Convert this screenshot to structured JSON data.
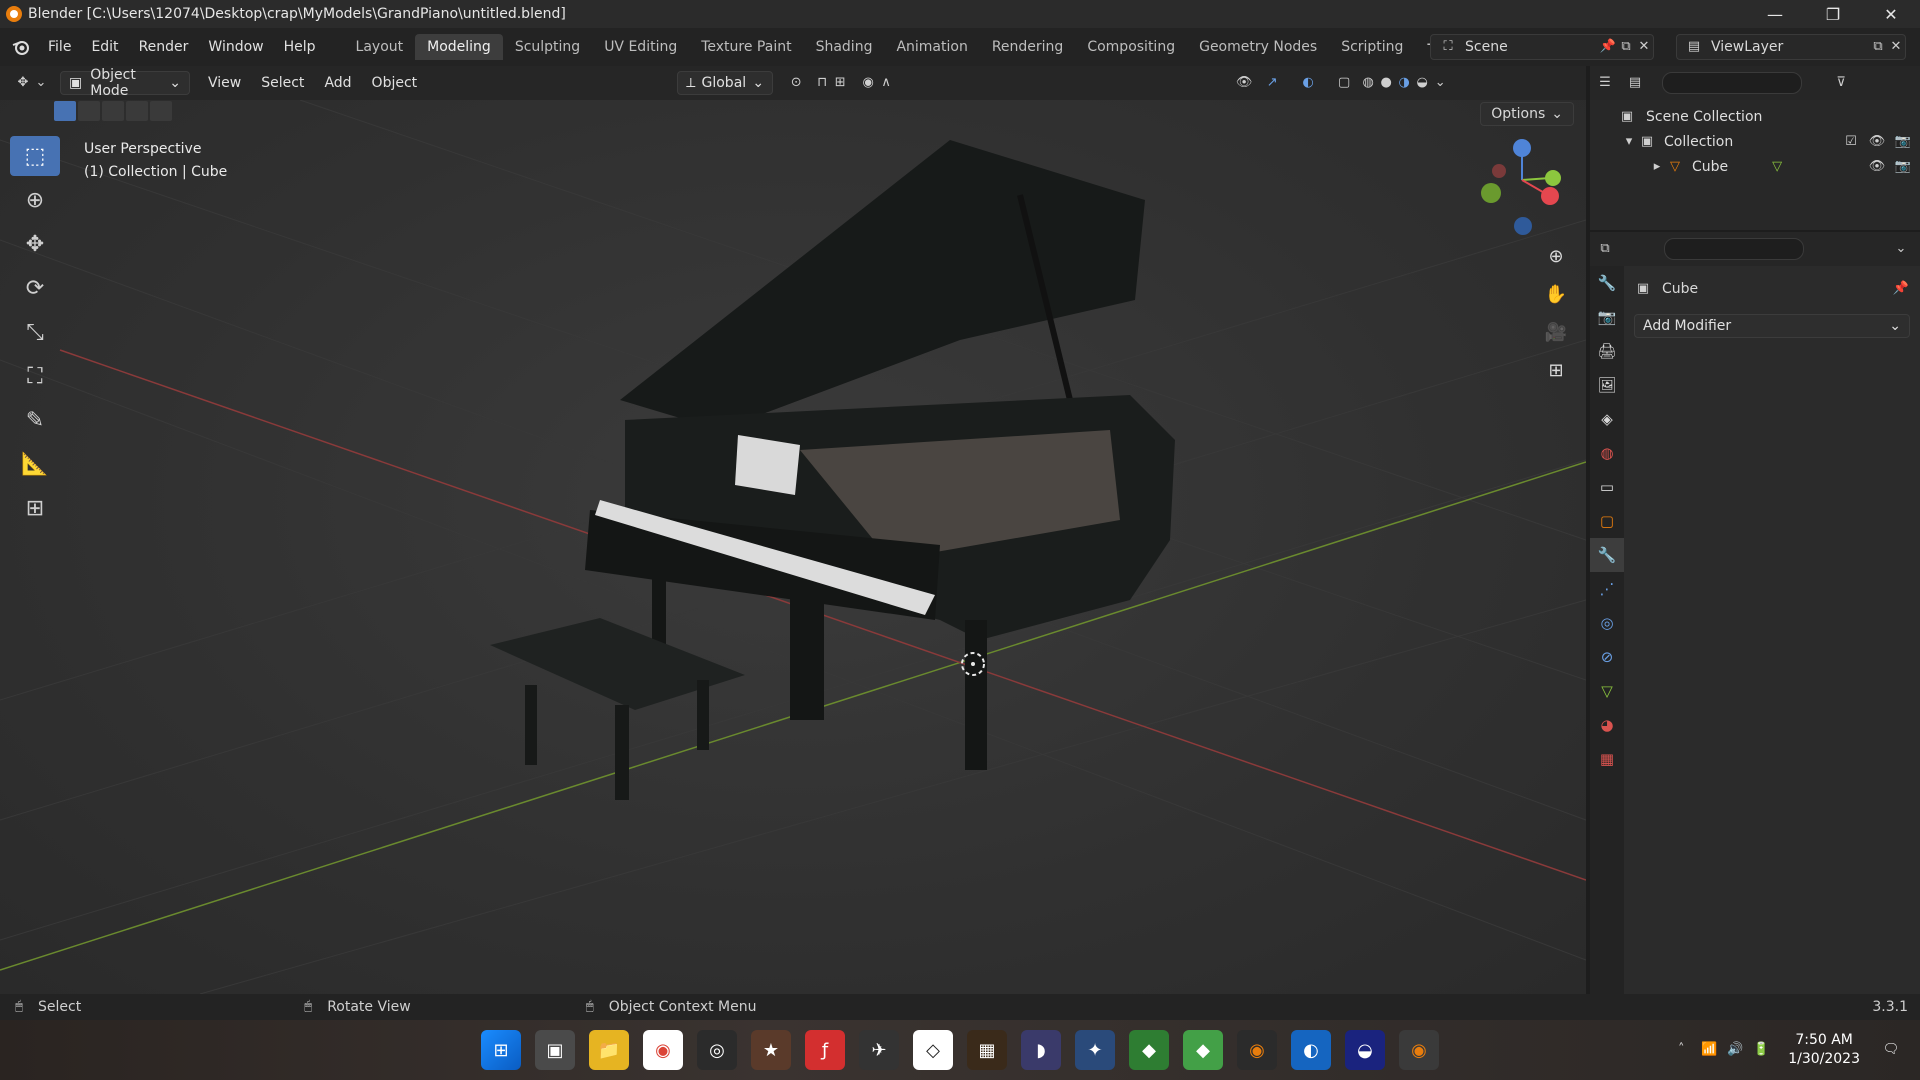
{
  "titlebar": {
    "title": "Blender [C:\\Users\\12074\\Desktop\\crap\\MyModels\\GrandPiano\\untitled.blend]",
    "minimize": "—",
    "restore": "❐",
    "close": "✕"
  },
  "menu": [
    "File",
    "Edit",
    "Render",
    "Window",
    "Help"
  ],
  "workspaces": [
    "Layout",
    "Modeling",
    "Sculpting",
    "UV Editing",
    "Texture Paint",
    "Shading",
    "Animation",
    "Rendering",
    "Compositing",
    "Geometry Nodes",
    "Scripting"
  ],
  "active_workspace": "Modeling",
  "workspace_add": "+",
  "scene": "Scene",
  "view_layer": "ViewLayer",
  "viewport_header": {
    "mode": "Object Mode",
    "menus": [
      "View",
      "Select",
      "Add",
      "Object"
    ],
    "transform_orientation": "Global",
    "options": "Options"
  },
  "viewport": {
    "perspective": "User Perspective",
    "collection_info": "(1) Collection | Cube",
    "gizmo": {
      "z": "Z",
      "y": "Y",
      "x": "X"
    }
  },
  "outliner": {
    "scene_collection": "Scene Collection",
    "collection": "Collection",
    "object": "Cube"
  },
  "properties": {
    "object_name": "Cube",
    "add_modifier": "Add Modifier"
  },
  "statusbar": {
    "select": "Select",
    "rotate": "Rotate View",
    "context_menu": "Object Context Menu",
    "version": "3.3.1"
  },
  "taskbar": {
    "time": "7:50 AM",
    "date": "1/30/2023"
  },
  "colors": {
    "accent": "#4772b3",
    "x_axis": "#e4474f",
    "y_axis": "#8cc63e",
    "z_axis": "#4f84d8",
    "blender_orange": "#e87d0d"
  }
}
